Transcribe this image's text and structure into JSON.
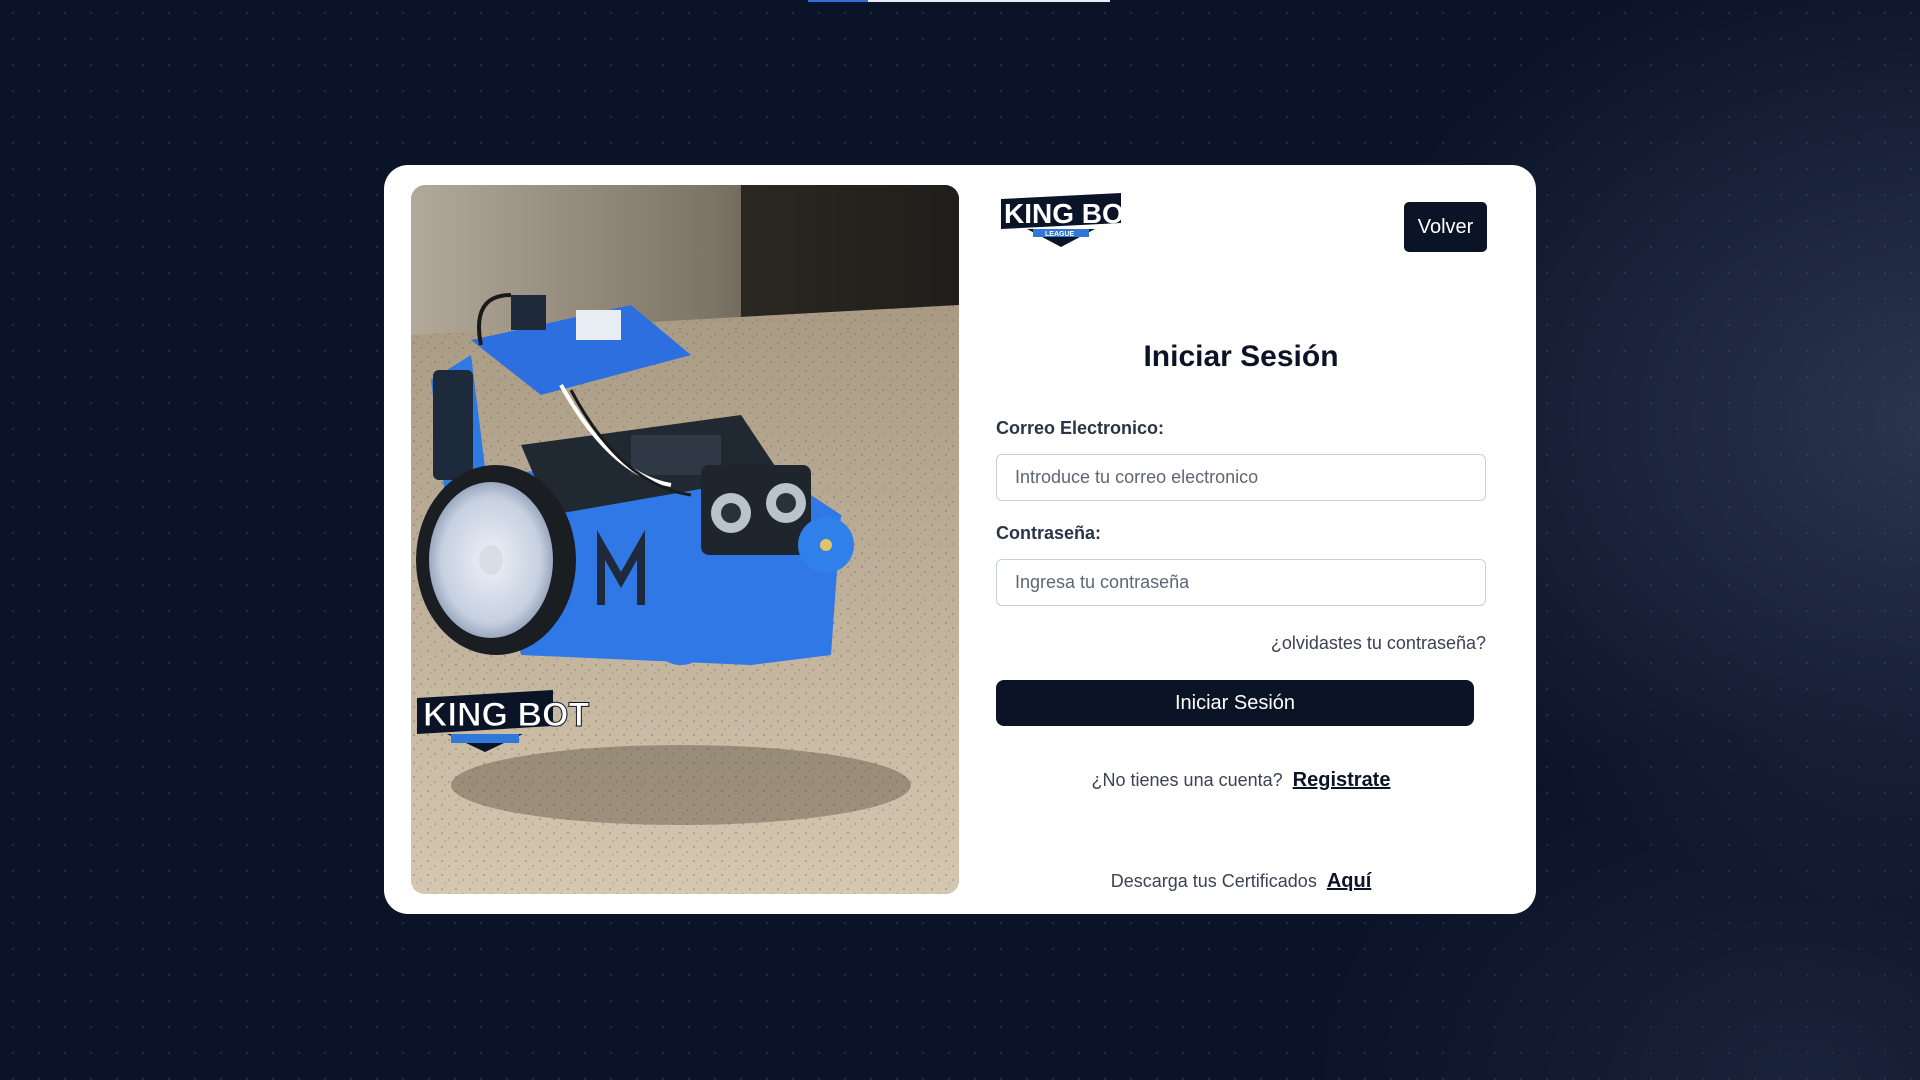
{
  "page": {
    "loading_progress": 0.2
  },
  "brand": {
    "logo_text_main": "KING BOT",
    "logo_text_sub": "LEAGUE",
    "logo_blue": "#2f78d8",
    "logo_dark": "#0b1326"
  },
  "header": {
    "back_label": "Volver"
  },
  "form": {
    "title": "Iniciar Sesión",
    "email_label": "Correo Electronico:",
    "email_placeholder": "Introduce tu correo electronico",
    "email_value": "",
    "password_label": "Contraseña:",
    "password_placeholder": "Ingresa tu contraseña",
    "password_value": "",
    "forgot_label": "¿olvidastes tu contraseña?",
    "submit_label": "Iniciar Sesión"
  },
  "footer": {
    "no_account_text": "¿No tienes una cuenta?",
    "register_link": "Registrate",
    "certificates_text": "Descarga tus Certificados",
    "certificates_link": "Aquí"
  },
  "colors": {
    "page_bg": "#0b1329",
    "card_bg": "#ffffff",
    "primary": "#0b1326"
  }
}
